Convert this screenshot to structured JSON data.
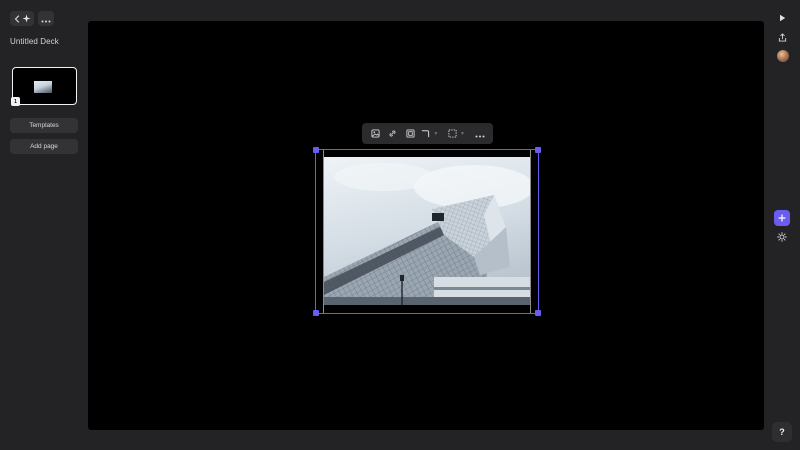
{
  "deck": {
    "title": "Untitled Deck"
  },
  "sidebar": {
    "pages": [
      {
        "number": "1",
        "selected": true
      }
    ],
    "templates_label": "Templates",
    "add_page_label": "Add page"
  },
  "toolbar": {
    "items": [
      "image-icon",
      "link-icon",
      "frame-icon",
      "corner-radius-icon",
      "border-style-icon",
      "more-icon"
    ]
  },
  "right_rail": {
    "icons": [
      "play-icon",
      "share-icon",
      "avatar",
      "plus-icon",
      "theme-icon",
      "help-icon"
    ]
  },
  "help_label": "?",
  "colors": {
    "background": "#232325",
    "canvas": "#000000",
    "accent": "#6a5cf0"
  }
}
